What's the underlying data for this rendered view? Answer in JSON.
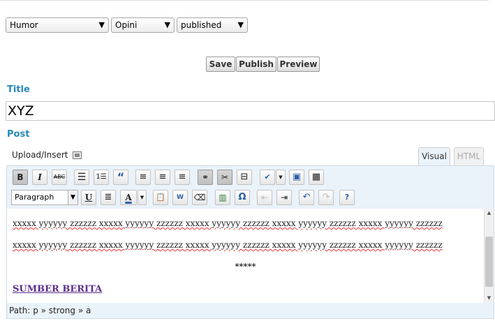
{
  "selects": {
    "category": "Humor",
    "opini": "Opini",
    "status": "published"
  },
  "actions": {
    "save": "Save",
    "publish": "Publish",
    "preview": "Preview"
  },
  "labels": {
    "title": "Title",
    "post": "Post",
    "upload_insert": "Upload/Insert"
  },
  "title_value": "XYZ",
  "tabs": {
    "visual": "Visual",
    "html": "HTML"
  },
  "toolbar": {
    "format_value": "Paragraph"
  },
  "content": {
    "para1": "xxxxx yyyyyy zzzzzz xxxxx yyyyyy zzzzzz xxxxx yyyyyy zzzzzz xxxxx yyyyyy zzzzzz xxxxx yyyyyy zzzzzz",
    "para2": "xxxxx yyyyyy zzzzzz xxxxx yyyyyy zzzzzz xxxxx yyyyyy zzzzzz xxxxx yyyyyy zzzzzz xxxxx yyyyyy zzzzzz",
    "stars": "*****",
    "link": "SUMBER BERITA"
  },
  "path": "Path: p » strong » a"
}
